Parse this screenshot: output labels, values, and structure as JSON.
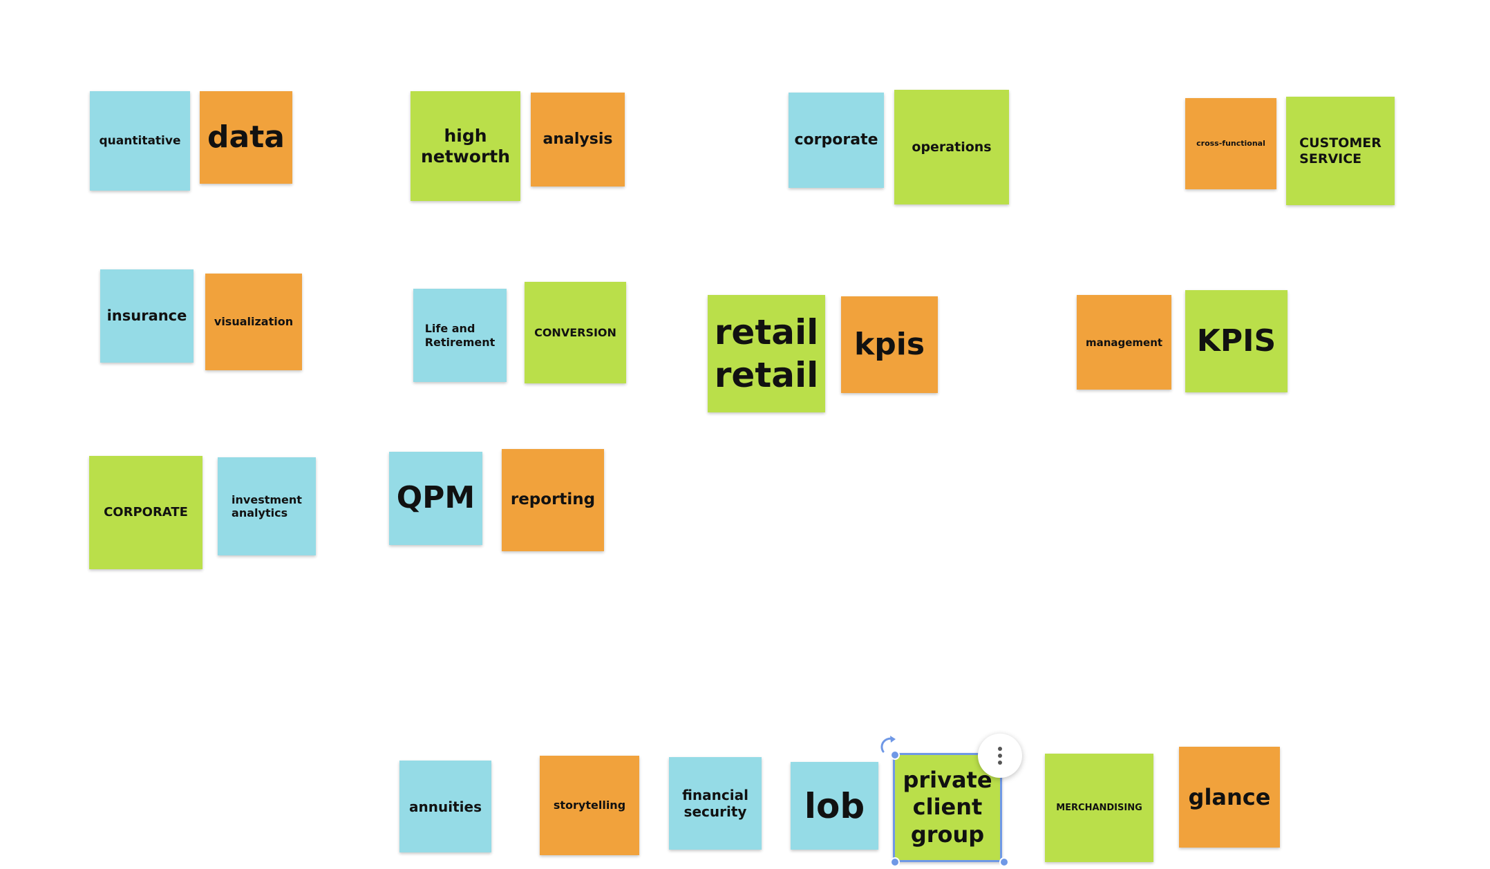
{
  "board": {
    "notes": {
      "quantitative": "quantitative",
      "data": "data",
      "high_networth": "high\nnetworth",
      "analysis": "analysis",
      "corporate_lower": "corporate",
      "operations": "operations",
      "cross_functional": "cross-functional",
      "customer_service": "CUSTOMER\nSERVICE",
      "insurance": "insurance",
      "visualization": "visualization",
      "life_and_retirement": "Life and\nRetirement",
      "conversion": "CONVERSION",
      "retail_retail": "retail\nretail",
      "kpis_lower": "kpis",
      "management": "management",
      "kpis_upper": "KPIS",
      "corporate_upper": "CORPORATE",
      "investment_analytics": "investment\nanalytics",
      "qpm": "QPM",
      "reporting": "reporting",
      "annuities": "annuities",
      "storytelling": "storytelling",
      "financial_security": "financial\nsecurity",
      "lob": "lob",
      "private_client_group": "private\nclient\ngroup",
      "merchandising": "MERCHANDISING",
      "glance": "glance"
    },
    "selected_note": "private_client_group",
    "selection_toolbar": {
      "more_icon": "vertical-ellipsis-icon",
      "rotate_icon": "rotate-icon"
    }
  },
  "colors": {
    "blue": "#95dbe6",
    "orange": "#f1a23c",
    "green": "#badf4a",
    "selection": "#6f98e6"
  }
}
